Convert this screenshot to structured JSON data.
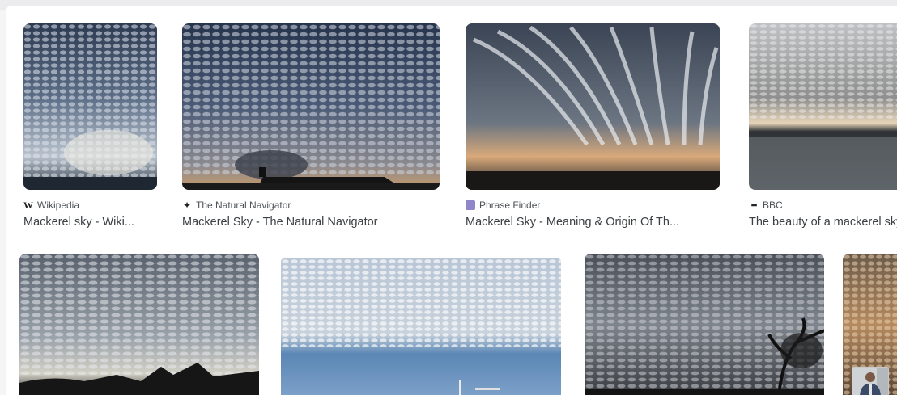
{
  "results": [
    {
      "source": "Wikipedia",
      "source_icon": "wikipedia-w-icon",
      "title": "Mackerel sky - Wiki..."
    },
    {
      "source": "The Natural Navigator",
      "source_icon": "star-compass-icon",
      "title": "Mackerel Sky - The Natural Navigator"
    },
    {
      "source": "Phrase Finder",
      "source_icon": "purple-square-icon",
      "title": "Mackerel Sky - Meaning & Origin Of Th..."
    },
    {
      "source": "BBC",
      "source_icon": "bbc-dots-icon",
      "title": "The beauty of a mackerel sky"
    }
  ],
  "colors": {
    "source_text": "#4d5156",
    "title_text": "#3c4043",
    "phrase_finder_icon": "#8e86c9"
  }
}
